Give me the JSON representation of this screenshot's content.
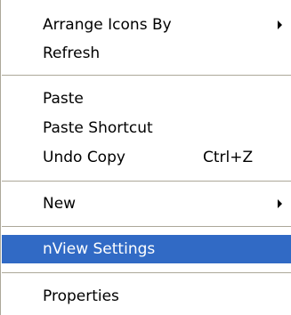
{
  "context_menu": {
    "items": [
      {
        "label": "Arrange Icons By",
        "shortcut": "",
        "has_submenu": true,
        "selected": false
      },
      {
        "label": "Refresh",
        "shortcut": "",
        "has_submenu": false,
        "selected": false
      },
      {
        "label": "Paste",
        "shortcut": "",
        "has_submenu": false,
        "selected": false
      },
      {
        "label": "Paste Shortcut",
        "shortcut": "",
        "has_submenu": false,
        "selected": false
      },
      {
        "label": "Undo Copy",
        "shortcut": "Ctrl+Z",
        "has_submenu": false,
        "selected": false
      },
      {
        "label": "New",
        "shortcut": "",
        "has_submenu": true,
        "selected": false
      },
      {
        "label": "nView Settings",
        "shortcut": "",
        "has_submenu": false,
        "selected": true
      },
      {
        "label": "Properties",
        "shortcut": "",
        "has_submenu": false,
        "selected": false
      }
    ]
  },
  "colors": {
    "selection_background": "#316ac5",
    "selection_text": "#ffffff",
    "separator": "#aca899",
    "menu_background": "#ffffff"
  }
}
